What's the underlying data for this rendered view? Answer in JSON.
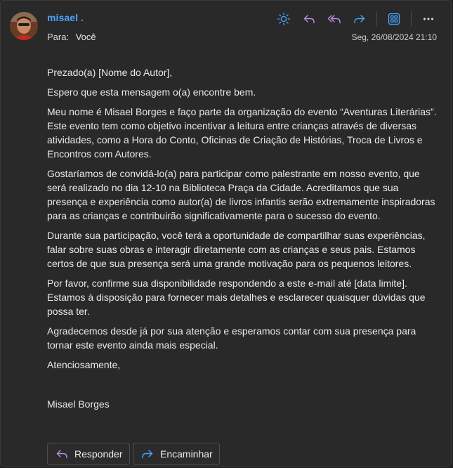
{
  "message": {
    "sender_name": "misael .",
    "to_label": "Para:",
    "to_value": "Você",
    "timestamp": "Seg, 26/08/2024 21:10"
  },
  "toolbar": {
    "icons": [
      "sun-icon",
      "reply-icon",
      "reply-all-icon",
      "forward-icon",
      "apps-icon",
      "more-icon"
    ]
  },
  "body": {
    "paragraphs": [
      "Prezado(a) [Nome do Autor],",
      "Espero que esta mensagem o(a) encontre bem.",
      "Meu nome é Misael Borges e faço parte da organização do evento “Aventuras Literárias”. Este evento tem como objetivo incentivar a leitura entre crianças através de diversas atividades, como a Hora do Conto, Oficinas de Criação de Histórias, Troca de Livros e Encontros com Autores.",
      "Gostaríamos de convidá-lo(a) para participar como palestrante em nosso evento, que será realizado no dia 12-10 na Biblioteca Praça da Cidade. Acreditamos que sua presença e experiência como autor(a) de livros infantis serão extremamente inspiradoras para as crianças e contribuirão significativamente para o sucesso do evento.",
      "Durante sua participação, você terá a oportunidade de compartilhar suas experiências, falar sobre suas obras e interagir diretamente com as crianças e seus pais. Estamos certos de que sua presença será uma grande motivação para os pequenos leitores.",
      "Por favor, confirme sua disponibilidade respondendo a este e-mail até [data limite]. Estamos à disposição para fornecer mais detalhes e esclarecer quaisquer dúvidas que possa ter.",
      "Agradecemos desde já por sua atenção e esperamos contar com sua presença para tornar este evento ainda mais especial.",
      "Atenciosamente,",
      "Misael Borges"
    ]
  },
  "actions": {
    "reply_label": "Responder",
    "forward_label": "Encaminhar"
  },
  "colors": {
    "accent": "#4aa3ff",
    "reply_icon": "#b58fe0",
    "forward_icon": "#4aa3ff"
  }
}
